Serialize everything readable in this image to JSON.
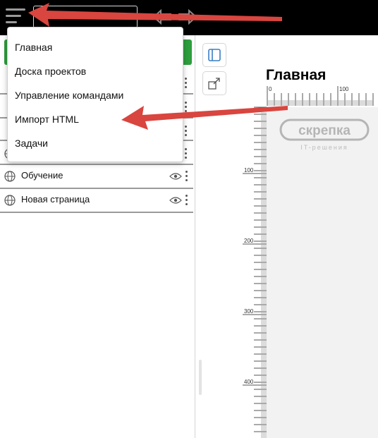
{
  "menu": {
    "items": [
      {
        "label": "Главная"
      },
      {
        "label": "Доска проектов"
      },
      {
        "label": "Управление командами"
      },
      {
        "label": "Импорт HTML"
      },
      {
        "label": "Задачи"
      }
    ]
  },
  "pages": {
    "items": [
      {
        "label": "Обучение"
      },
      {
        "label": "Новая страница"
      }
    ]
  },
  "canvas": {
    "title": "Главная",
    "ruler_h_labels": [
      "0",
      "100"
    ],
    "ruler_v_labels": [
      "100",
      "200",
      "300",
      "400"
    ],
    "logo": {
      "text": "скрепка",
      "tagline": "IT-решения"
    }
  },
  "colors": {
    "topbar": "#000000",
    "add_button": "#2e9e3e",
    "annotation_arrow": "#d9453f",
    "canvas_background": "#f2f2f2"
  },
  "icons": {
    "menu": "hamburger-icon",
    "undo": "undo-arrow-icon",
    "redo": "redo-arrow-icon",
    "page": "globe-icon",
    "visibility": "eye-icon",
    "more": "vertical-dots-icon",
    "panel": "panel-toggle-icon",
    "expand": "expand-icon"
  }
}
